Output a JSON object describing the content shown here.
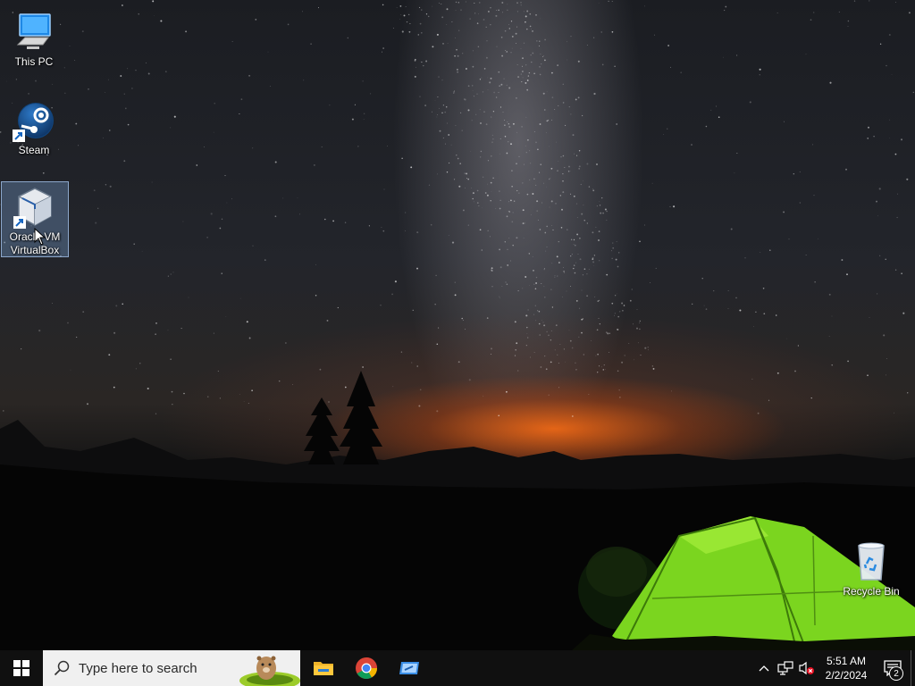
{
  "desktop": {
    "icons": [
      {
        "label": "This PC",
        "icon": "computer-icon"
      },
      {
        "label": "Steam",
        "icon": "steam-icon"
      },
      {
        "label": "Oracle VM VirtualBox",
        "icon": "virtualbox-icon",
        "selected": true
      },
      {
        "label": "Recycle Bin",
        "icon": "recycle-bin-icon"
      }
    ]
  },
  "taskbar": {
    "search_placeholder": "Type here to search",
    "pinned": [
      {
        "name": "File Explorer",
        "icon": "folder-icon"
      },
      {
        "name": "Google Chrome",
        "icon": "chrome-icon"
      },
      {
        "name": "Remote Desktop",
        "icon": "remote-desktop-icon"
      }
    ],
    "tray": {
      "clock_time": "5:51 AM",
      "clock_date": "2/2/2024",
      "notification_count": "2"
    }
  },
  "colors": {
    "taskbar_bg": "#101010",
    "search_bg": "#f0f0f0",
    "selection": "#78a0d2"
  }
}
